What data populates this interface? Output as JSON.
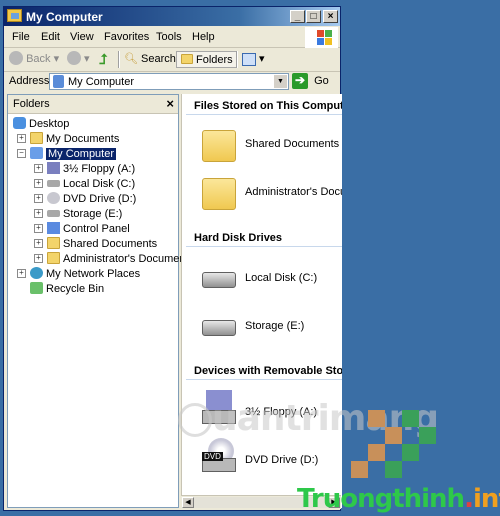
{
  "window": {
    "title": "My Computer",
    "controls": {
      "minimize": "_",
      "maximize": "□",
      "close": "×"
    }
  },
  "menu": [
    "File",
    "Edit",
    "View",
    "Favorites",
    "Tools",
    "Help"
  ],
  "toolbar": {
    "back_label": "Back",
    "search_label": "Search",
    "folders_label": "Folders",
    "views_icon": "views-icon"
  },
  "address": {
    "label": "Address",
    "value": "My Computer",
    "go_label": "Go"
  },
  "folders_pane": {
    "title": "Folders",
    "close": "×",
    "tree": [
      {
        "label": "Desktop",
        "icon": "desktop-icon",
        "level": 0,
        "expander": ""
      },
      {
        "label": "My Documents",
        "icon": "my-documents-icon",
        "level": 1,
        "expander": "+"
      },
      {
        "label": "My Computer",
        "icon": "my-computer-icon",
        "level": 1,
        "expander": "−",
        "selected": true
      },
      {
        "label": "3½ Floppy (A:)",
        "icon": "floppy-icon",
        "level": 2,
        "expander": "+"
      },
      {
        "label": "Local Disk (C:)",
        "icon": "hard-disk-icon",
        "level": 2,
        "expander": "+"
      },
      {
        "label": "DVD Drive (D:)",
        "icon": "dvd-drive-icon",
        "level": 2,
        "expander": "+"
      },
      {
        "label": "Storage (E:)",
        "icon": "hard-disk-icon",
        "level": 2,
        "expander": "+"
      },
      {
        "label": "Control Panel",
        "icon": "control-panel-icon",
        "level": 2,
        "expander": "+"
      },
      {
        "label": "Shared Documents",
        "icon": "folder-icon",
        "level": 2,
        "expander": "+"
      },
      {
        "label": "Administrator's Documents",
        "icon": "folder-icon",
        "level": 2,
        "expander": "+"
      },
      {
        "label": "My Network Places",
        "icon": "network-places-icon",
        "level": 1,
        "expander": "+"
      },
      {
        "label": "Recycle Bin",
        "icon": "recycle-bin-icon",
        "level": 1,
        "expander": ""
      }
    ]
  },
  "content": {
    "sections": [
      {
        "title": "Files Stored on This Computer",
        "items": [
          "Shared Documents",
          "Administrator's Documents"
        ]
      },
      {
        "title": "Hard Disk Drives",
        "items": [
          "Local Disk (C:)",
          "Storage (E:)"
        ]
      },
      {
        "title": "Devices with Removable Storage",
        "items": [
          "3½ Floppy (A:)",
          "DVD Drive (D:)"
        ]
      }
    ],
    "dvd_badge": "DVD"
  },
  "watermarks": {
    "quantrimang": "uantrimang",
    "truongthinh_main": "Truongthinh",
    "truongthinh_dot": ".",
    "truongthinh_tld": "info"
  }
}
